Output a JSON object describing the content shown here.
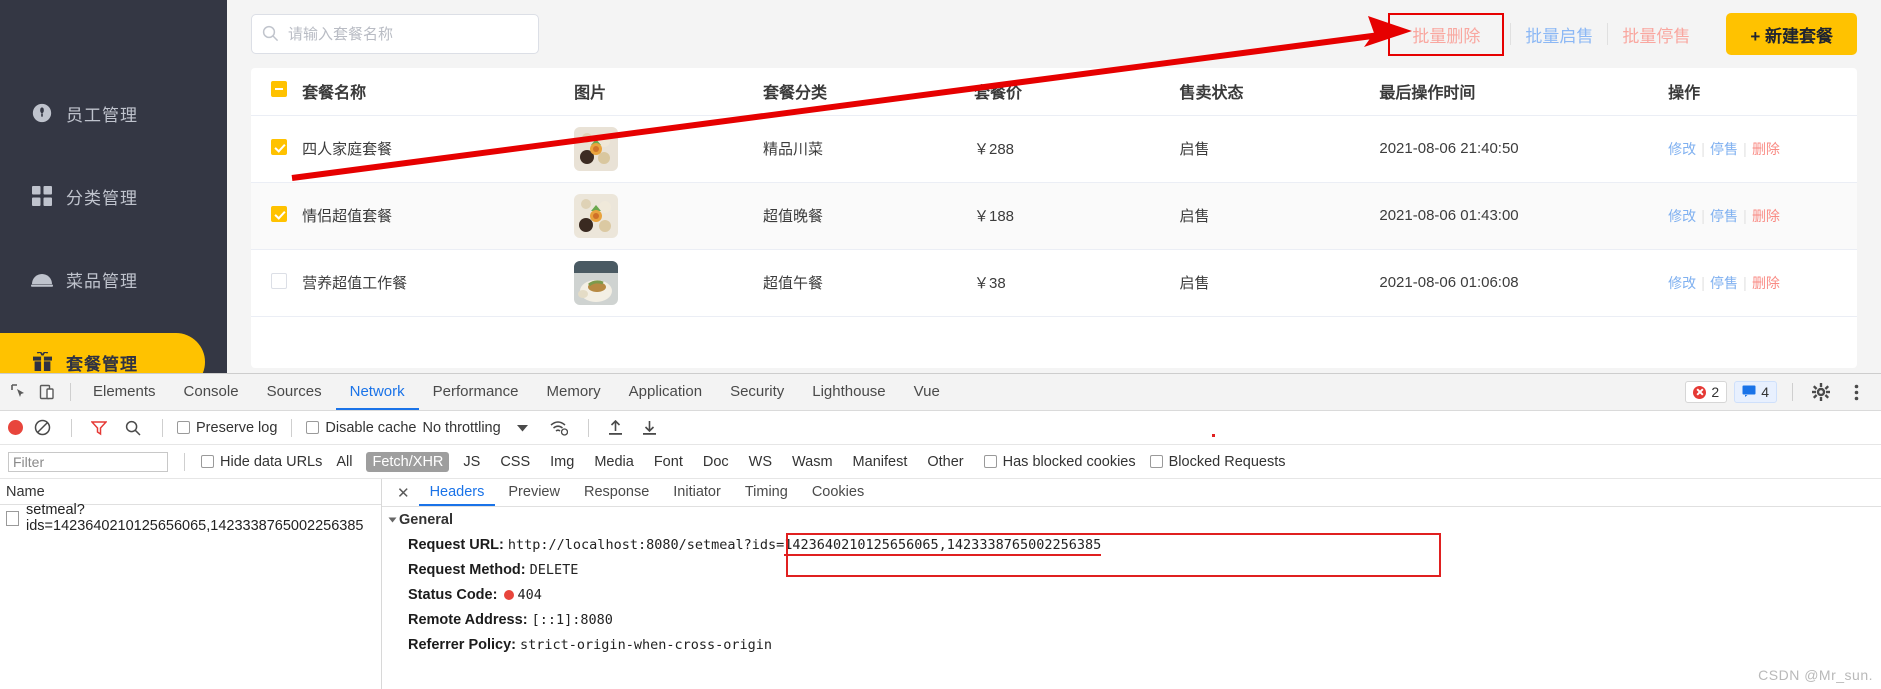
{
  "sidebar": {
    "items": [
      {
        "label": "员工管理",
        "icon": "user-icon",
        "active": false
      },
      {
        "label": "分类管理",
        "icon": "grid-icon",
        "active": false
      },
      {
        "label": "菜品管理",
        "icon": "dish-cover-icon",
        "active": false
      },
      {
        "label": "套餐管理",
        "icon": "gift-icon",
        "active": true
      }
    ]
  },
  "toolbar": {
    "search_placeholder": "请输入套餐名称",
    "search_value": "",
    "batch_delete": "批量删除",
    "batch_enable": "批量启售",
    "batch_disable": "批量停售",
    "new_setmeal": "+ 新建套餐",
    "colors": {
      "disabled_red": "#f9a7a0",
      "disabled_blue": "#8cb8f5",
      "brand_yellow": "#ffc200",
      "highlight_red": "#e60000"
    }
  },
  "table": {
    "headers": [
      "套餐名称",
      "图片",
      "套餐分类",
      "套餐价",
      "售卖状态",
      "最后操作时间",
      "操作"
    ],
    "header_checkbox_state": "indeterminate",
    "rows": [
      {
        "checked": true,
        "name": "四人家庭套餐",
        "category": "精品川菜",
        "price": "￥288",
        "status": "启售",
        "time": "2021-08-06 21:40:50",
        "actions": [
          "修改",
          "停售",
          "删除"
        ]
      },
      {
        "checked": true,
        "name": "情侣超值套餐",
        "category": "超值晚餐",
        "price": "￥188",
        "status": "启售",
        "time": "2021-08-06 01:43:00",
        "actions": [
          "修改",
          "停售",
          "删除"
        ]
      },
      {
        "checked": false,
        "name": "营养超值工作餐",
        "category": "超值午餐",
        "price": "￥38",
        "status": "启售",
        "time": "2021-08-06 01:06:08",
        "actions": [
          "修改",
          "停售",
          "删除"
        ]
      }
    ]
  },
  "devtools": {
    "panels": [
      "Elements",
      "Console",
      "Sources",
      "Network",
      "Performance",
      "Memory",
      "Application",
      "Security",
      "Lighthouse",
      "Vue"
    ],
    "active_panel": "Network",
    "error_count": "2",
    "message_count": "4",
    "network_toolbar": {
      "preserve_log": "Preserve log",
      "disable_cache": "Disable cache",
      "throttling": "No throttling"
    },
    "filter_bar": {
      "filter_placeholder": "Filter",
      "filter_value": "",
      "hide_data_urls": "Hide data URLs",
      "types": [
        "All",
        "Fetch/XHR",
        "JS",
        "CSS",
        "Img",
        "Media",
        "Font",
        "Doc",
        "WS",
        "Wasm",
        "Manifest",
        "Other"
      ],
      "selected_type": "Fetch/XHR",
      "has_blocked_cookies": "Has blocked cookies",
      "blocked_requests": "Blocked Requests"
    },
    "requests": {
      "column_header": "Name",
      "items": [
        "setmeal?ids=1423640210125656065,1423338765002256385"
      ]
    },
    "detail": {
      "tabs": [
        "Headers",
        "Preview",
        "Response",
        "Initiator",
        "Timing",
        "Cookies"
      ],
      "active_tab": "Headers",
      "close_label": "✕",
      "section_title": "General",
      "fields": [
        {
          "key": "Request URL:",
          "value": "http://localhost:8080/setmeal?ids=",
          "underlined": "1423640210125656065,1423338765002256385"
        },
        {
          "key": "Request Method:",
          "value": "DELETE"
        },
        {
          "key": "Status Code:",
          "value": "404",
          "status_dot": true
        },
        {
          "key": "Remote Address:",
          "value": "[::1]:8080"
        },
        {
          "key": "Referrer Policy:",
          "value": "strict-origin-when-cross-origin"
        }
      ]
    }
  },
  "watermark": "CSDN @Mr_sun."
}
